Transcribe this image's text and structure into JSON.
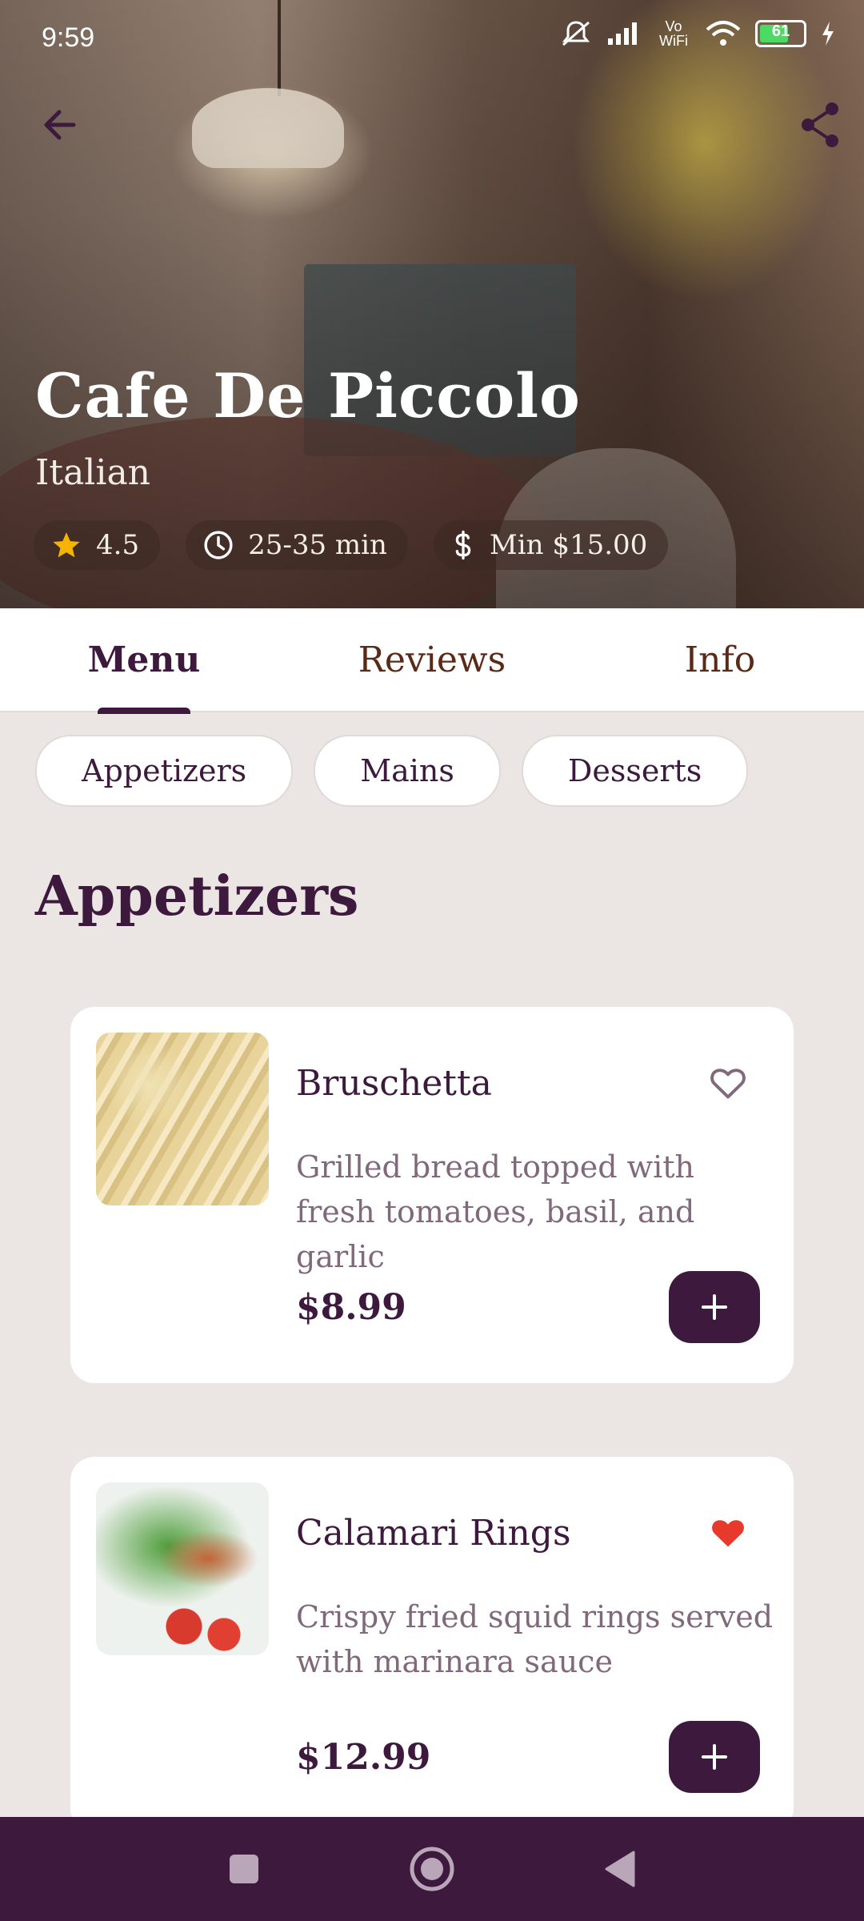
{
  "status_bar": {
    "time": "9:59",
    "battery": "61",
    "network_label": "Vo WiFi"
  },
  "restaurant": {
    "name": "Cafe De Piccolo",
    "cuisine": "Italian",
    "rating": "4.5",
    "delivery_time": "25-35 min",
    "min_order": "Min $15.00"
  },
  "tabs": [
    {
      "label": "Menu",
      "active": true
    },
    {
      "label": "Reviews",
      "active": false
    },
    {
      "label": "Info",
      "active": false
    }
  ],
  "categories": [
    "Appetizers",
    "Mains",
    "Desserts"
  ],
  "section_title": "Appetizers",
  "menu_items": [
    {
      "name": "Bruschetta",
      "description": "Grilled bread topped with fresh tomatoes, basil, and garlic",
      "price": "$8.99",
      "favorite": false,
      "image": "pasta-photo"
    },
    {
      "name": "Calamari Rings",
      "description": "Crispy fried squid rings served with marinara sauce",
      "price": "$12.99",
      "favorite": true,
      "image": "salmon-salad-photo"
    }
  ],
  "colors": {
    "primary": "#3d1a3d",
    "background": "#ebe6e3",
    "accent_star": "#f5b400",
    "favorite_heart": "#e8392d",
    "muted_text": "#80697a"
  }
}
